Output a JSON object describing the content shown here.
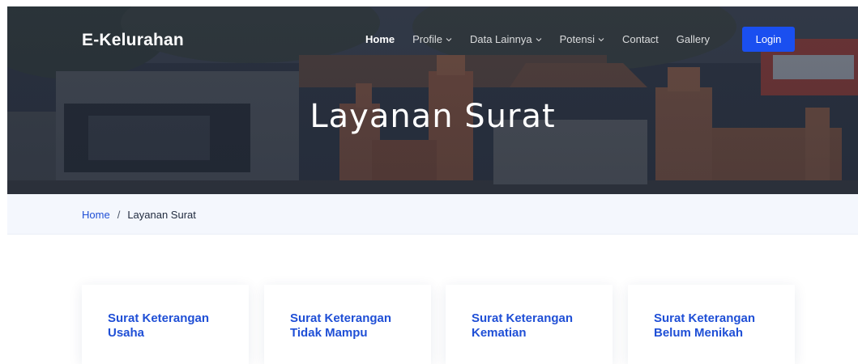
{
  "brand": {
    "name": "E-Kelurahan"
  },
  "nav": {
    "items": [
      {
        "label": "Home",
        "active": true,
        "dropdown": false
      },
      {
        "label": "Profile",
        "active": false,
        "dropdown": true
      },
      {
        "label": "Data Lainnya",
        "active": false,
        "dropdown": true
      },
      {
        "label": "Potensi",
        "active": false,
        "dropdown": true
      },
      {
        "label": "Contact",
        "active": false,
        "dropdown": false
      },
      {
        "label": "Gallery",
        "active": false,
        "dropdown": false
      }
    ],
    "login_label": "Login"
  },
  "hero": {
    "title": "Layanan Surat"
  },
  "breadcrumb": {
    "home": "Home",
    "separator": "/",
    "current": "Layanan Surat"
  },
  "cards": [
    {
      "line1": "Surat Keterangan",
      "line2": "Usaha"
    },
    {
      "line1": "Surat Keterangan",
      "line2": "Tidak Mampu"
    },
    {
      "line1": "Surat Keterangan",
      "line2": "Kematian"
    },
    {
      "line1": "Surat Keterangan",
      "line2": "Belum Menikah"
    }
  ],
  "colors": {
    "accent": "#1f4fd6",
    "login_button": "#1a4ff0",
    "breadcrumb_bar": "#f4f7fd"
  }
}
